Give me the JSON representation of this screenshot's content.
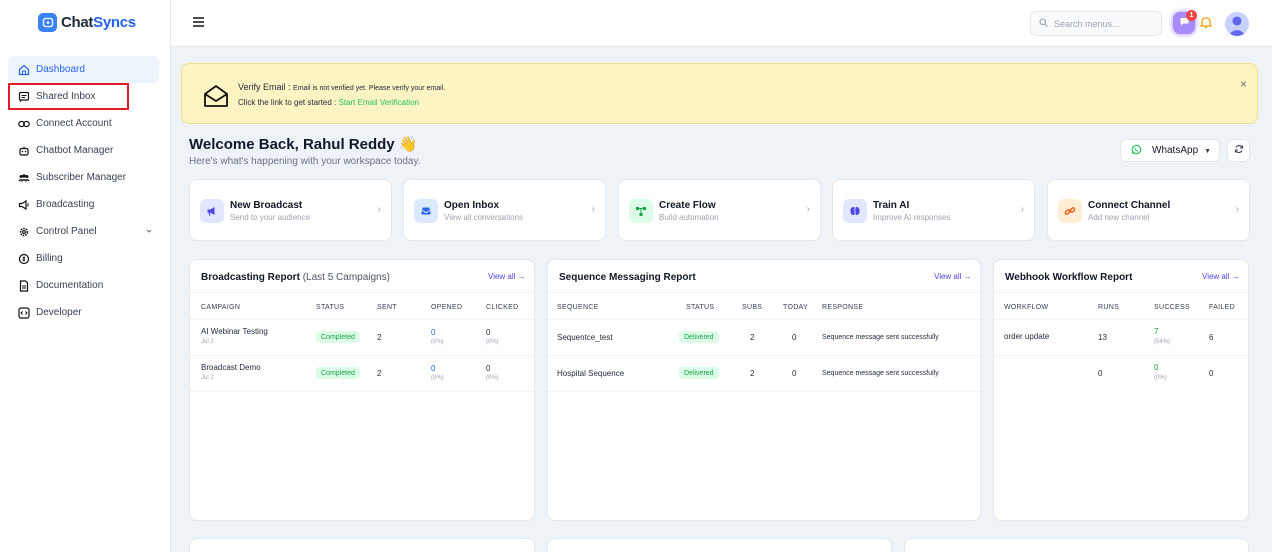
{
  "brand": {
    "name_part1": "Chat",
    "name_part2": "Syncs"
  },
  "sidebar": {
    "items": [
      {
        "label": "Dashboard",
        "icon": "home-icon"
      },
      {
        "label": "Shared Inbox",
        "icon": "inbox-icon"
      },
      {
        "label": "Connect Account",
        "icon": "link-icon"
      },
      {
        "label": "Chatbot Manager",
        "icon": "bot-icon"
      },
      {
        "label": "Subscriber Manager",
        "icon": "users-icon"
      },
      {
        "label": "Broadcasting",
        "icon": "megaphone-icon"
      },
      {
        "label": "Control Panel",
        "icon": "gear-icon"
      },
      {
        "label": "Billing",
        "icon": "billing-icon"
      },
      {
        "label": "Documentation",
        "icon": "document-icon"
      },
      {
        "label": "Developer",
        "icon": "code-icon"
      }
    ]
  },
  "topbar": {
    "search_placeholder": "Search menus...",
    "chat_badge": "1"
  },
  "alert": {
    "title": "Verify Email :",
    "message": "Email is not verified yet. Please verify your email.",
    "line2_prefix": "Click the link to get started :",
    "link": "Start Email Verification",
    "close": "×"
  },
  "welcome": {
    "title": "Welcome Back, Rahul Reddy",
    "emoji": "👋",
    "subtitle": "Here's what's happening with your workspace today.",
    "channel": "WhatsApp"
  },
  "quick_actions": [
    {
      "title": "New Broadcast",
      "subtitle": "Send to your audience",
      "icon": "megaphone-icon",
      "color": "#e0e7ff"
    },
    {
      "title": "Open Inbox",
      "subtitle": "View all conversations",
      "icon": "inbox-icon",
      "color": "#dbeafe"
    },
    {
      "title": "Create Flow",
      "subtitle": "Build automation",
      "icon": "flow-icon",
      "color": "#dcfce7"
    },
    {
      "title": "Train AI",
      "subtitle": "Improve AI responses",
      "icon": "brain-icon",
      "color": "#e0e7ff"
    },
    {
      "title": "Connect Channel",
      "subtitle": "Add new channel",
      "icon": "link-icon",
      "color": "#ffedd5"
    }
  ],
  "broadcast_report": {
    "title": "Broadcasting Report",
    "title_suffix": "(Last 5 Campaigns)",
    "view_all": "View all",
    "columns": [
      "CAMPAIGN",
      "STATUS",
      "SENT",
      "OPENED",
      "CLICKED"
    ],
    "rows": [
      {
        "campaign": "AI Webinar Testing",
        "date": "Jul 2",
        "status": "Completed",
        "sent": "2",
        "opened": "0",
        "opened_pct": "(0%)",
        "clicked": "0",
        "clicked_pct": "(0%)"
      },
      {
        "campaign": "Broadcast Demo",
        "date": "Jul 2",
        "status": "Completed",
        "sent": "2",
        "opened": "0",
        "opened_pct": "(0%)",
        "clicked": "0",
        "clicked_pct": "(0%)"
      }
    ]
  },
  "sequence_report": {
    "title": "Sequence Messaging Report",
    "view_all": "View all",
    "columns": [
      "SEQUENCE",
      "STATUS",
      "SUBS",
      "TODAY",
      "RESPONSE"
    ],
    "rows": [
      {
        "sequence": "Sequentce_test",
        "status": "Delivered",
        "subs": "2",
        "today": "0",
        "response": "Sequence message sent successfully"
      },
      {
        "sequence": "Hospital Sequence",
        "status": "Delivered",
        "subs": "2",
        "today": "0",
        "response": "Sequence message sent successfully"
      }
    ]
  },
  "webhook_report": {
    "title": "Webhook Workflow Report",
    "view_all": "View all",
    "columns": [
      "WORKFLOW",
      "RUNS",
      "SUCCESS",
      "FAILED"
    ],
    "rows": [
      {
        "workflow": "order update",
        "runs": "13",
        "success": "7",
        "success_pct": "(54%)",
        "failed": "6"
      },
      {
        "workflow": "",
        "runs": "0",
        "success": "0",
        "success_pct": "(0%)",
        "failed": "0"
      }
    ]
  }
}
